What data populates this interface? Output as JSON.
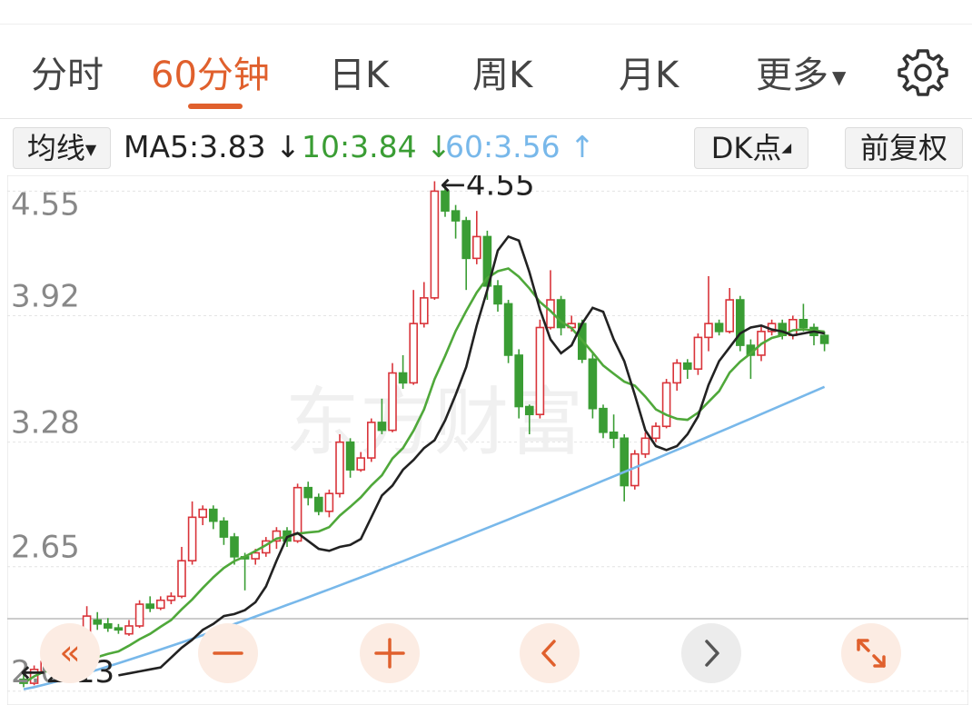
{
  "tabs": [
    {
      "label": "分时",
      "active": false
    },
    {
      "label": "60分钟",
      "active": true
    },
    {
      "label": "日K",
      "active": false
    },
    {
      "label": "周K",
      "active": false
    },
    {
      "label": "月K",
      "active": false
    },
    {
      "label": "更多",
      "active": false
    }
  ],
  "toolbar": {
    "ma_selector": "均线",
    "ma5": "MA5:3.83",
    "ma5_arrow": "↓",
    "ma10": "10:3.84",
    "ma10_arrow": "↓",
    "ma60": "60:3.56",
    "ma60_arrow": "↑",
    "dk_button": "DK点",
    "adjust_button": "前复权"
  },
  "colors": {
    "accent": "#e0602d",
    "up": "#d9343a",
    "down": "#3a9d34",
    "ma5": "#222222",
    "ma10": "#4fa83a",
    "ma60": "#78b8ea"
  },
  "icons": {
    "settings": "gear-icon",
    "collapse": "double-chevron-left-icon",
    "zoom_out": "minus-icon",
    "zoom_in": "plus-icon",
    "prev": "chevron-left-icon",
    "next": "chevron-right-icon",
    "fullscreen": "expand-icon"
  },
  "chart_data": {
    "type": "candlestick",
    "watermark": "东方财富",
    "y_ticks": [
      "4.55",
      "3.92",
      "3.28",
      "2.65",
      "2.02"
    ],
    "ylim": [
      1.95,
      4.63
    ],
    "grid": true,
    "annotations": {
      "high": "←4.55",
      "low": "←2.13"
    },
    "candles": [
      [
        2.08,
        2.06,
        2.12,
        2.04
      ],
      [
        2.06,
        2.13,
        2.15,
        2.05
      ],
      [
        2.12,
        2.17,
        2.19,
        2.1
      ],
      [
        2.17,
        2.12,
        2.19,
        2.1
      ],
      [
        2.12,
        2.16,
        2.18,
        2.11
      ],
      [
        2.16,
        2.14,
        2.18,
        2.12
      ],
      [
        2.14,
        2.4,
        2.45,
        2.13
      ],
      [
        2.38,
        2.36,
        2.42,
        2.33
      ],
      [
        2.36,
        2.34,
        2.39,
        2.32
      ],
      [
        2.34,
        2.33,
        2.36,
        2.31
      ],
      [
        2.31,
        2.35,
        2.38,
        2.3
      ],
      [
        2.35,
        2.46,
        2.48,
        2.34
      ],
      [
        2.46,
        2.44,
        2.5,
        2.42
      ],
      [
        2.44,
        2.48,
        2.5,
        2.43
      ],
      [
        2.48,
        2.5,
        2.52,
        2.46
      ],
      [
        2.5,
        2.68,
        2.75,
        2.49
      ],
      [
        2.68,
        2.9,
        2.98,
        2.66
      ],
      [
        2.9,
        2.94,
        2.96,
        2.86
      ],
      [
        2.94,
        2.88,
        2.96,
        2.84
      ],
      [
        2.88,
        2.8,
        2.9,
        2.76
      ],
      [
        2.8,
        2.7,
        2.82,
        2.66
      ],
      [
        2.7,
        2.69,
        2.72,
        2.53
      ],
      [
        2.69,
        2.72,
        2.74,
        2.66
      ],
      [
        2.72,
        2.78,
        2.8,
        2.7
      ],
      [
        2.78,
        2.83,
        2.85,
        2.74
      ],
      [
        2.83,
        2.78,
        2.85,
        2.75
      ],
      [
        2.78,
        3.05,
        3.07,
        2.77
      ],
      [
        3.05,
        3.0,
        3.08,
        2.96
      ],
      [
        3.0,
        2.93,
        3.02,
        2.91
      ],
      [
        2.93,
        3.02,
        3.04,
        2.9
      ],
      [
        3.02,
        3.28,
        3.32,
        3.0
      ],
      [
        3.28,
        3.14,
        3.3,
        3.1
      ],
      [
        3.14,
        3.2,
        3.23,
        3.13
      ],
      [
        3.2,
        3.38,
        3.4,
        3.18
      ],
      [
        3.38,
        3.34,
        3.5,
        3.32
      ],
      [
        3.34,
        3.63,
        3.68,
        3.33
      ],
      [
        3.63,
        3.58,
        3.72,
        3.55
      ],
      [
        3.58,
        3.88,
        4.05,
        3.57
      ],
      [
        3.88,
        4.01,
        4.09,
        3.86
      ],
      [
        4.01,
        4.55,
        4.6,
        4.0
      ],
      [
        4.55,
        4.45,
        4.57,
        4.42
      ],
      [
        4.45,
        4.4,
        4.48,
        4.31
      ],
      [
        4.4,
        4.21,
        4.42,
        4.05
      ],
      [
        4.21,
        4.32,
        4.45,
        4.18
      ],
      [
        4.32,
        4.07,
        4.35,
        4.0
      ],
      [
        4.07,
        3.98,
        4.1,
        3.94
      ],
      [
        3.98,
        3.72,
        4.0,
        3.68
      ],
      [
        3.72,
        3.46,
        3.75,
        3.4
      ],
      [
        3.46,
        3.42,
        3.47,
        3.32
      ],
      [
        3.42,
        3.86,
        3.9,
        3.4
      ],
      [
        3.86,
        4.0,
        4.15,
        3.85
      ],
      [
        4.0,
        3.86,
        4.02,
        3.82
      ],
      [
        3.86,
        3.88,
        3.92,
        3.84
      ],
      [
        3.88,
        3.7,
        3.9,
        3.68
      ],
      [
        3.7,
        3.45,
        3.73,
        3.4
      ],
      [
        3.45,
        3.33,
        3.47,
        3.3
      ],
      [
        3.33,
        3.3,
        3.42,
        3.25
      ],
      [
        3.3,
        3.06,
        3.32,
        2.98
      ],
      [
        3.06,
        3.22,
        3.24,
        3.04
      ],
      [
        3.22,
        3.3,
        3.33,
        3.2
      ],
      [
        3.3,
        3.36,
        3.38,
        3.28
      ],
      [
        3.36,
        3.58,
        3.6,
        3.35
      ],
      [
        3.58,
        3.68,
        3.7,
        3.54
      ],
      [
        3.68,
        3.65,
        3.7,
        3.6
      ],
      [
        3.65,
        3.81,
        3.83,
        3.62
      ],
      [
        3.81,
        3.88,
        4.12,
        3.74
      ],
      [
        3.88,
        3.84,
        3.9,
        3.82
      ],
      [
        3.84,
        4.0,
        4.06,
        3.83
      ],
      [
        4.0,
        3.77,
        4.02,
        3.74
      ],
      [
        3.77,
        3.72,
        3.8,
        3.6
      ],
      [
        3.72,
        3.84,
        3.87,
        3.69
      ],
      [
        3.84,
        3.88,
        3.9,
        3.82
      ],
      [
        3.88,
        3.82,
        3.9,
        3.8
      ],
      [
        3.82,
        3.9,
        3.92,
        3.8
      ],
      [
        3.9,
        3.86,
        3.98,
        3.84
      ],
      [
        3.86,
        3.82,
        3.88,
        3.77
      ],
      [
        3.82,
        3.78,
        3.84,
        3.74
      ]
    ],
    "ma5": [
      2.1,
      2.11,
      2.12,
      2.13,
      2.14,
      2.19,
      2.24,
      2.28,
      2.33,
      2.36,
      2.4,
      2.41,
      2.43,
      2.47,
      2.55,
      2.68,
      2.8,
      2.82,
      2.78,
      2.74,
      2.73,
      2.75,
      2.76,
      2.79,
      2.9,
      3.01,
      3.06,
      3.14,
      3.19,
      3.25,
      3.29,
      3.39,
      3.52,
      3.66,
      3.87,
      4.05,
      4.25,
      4.32,
      4.3,
      4.14,
      3.95,
      3.8,
      3.73,
      3.77,
      3.88,
      3.96,
      3.94,
      3.8,
      3.69,
      3.52,
      3.34,
      3.26,
      3.24,
      3.26,
      3.32,
      3.41,
      3.57,
      3.69,
      3.76,
      3.83,
      3.86,
      3.87,
      3.85,
      3.84,
      3.82,
      3.83,
      3.84,
      3.83
    ]
  },
  "controls": {
    "collapse_glyph": "«"
  }
}
